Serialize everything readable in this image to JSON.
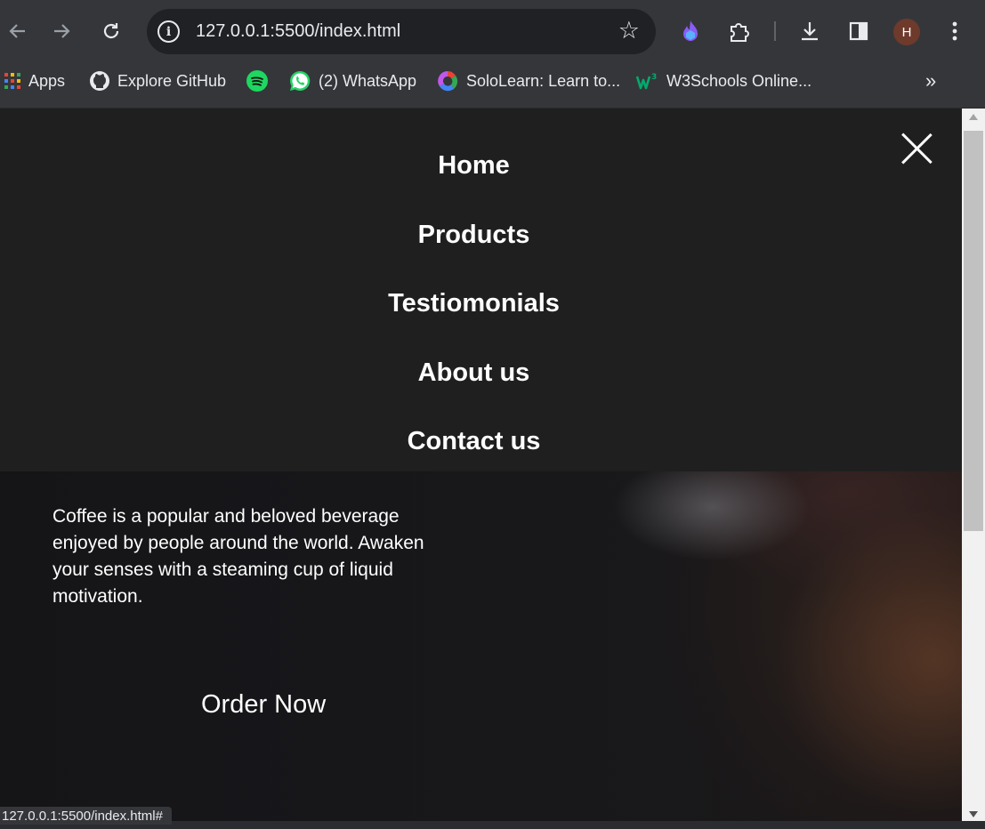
{
  "browser": {
    "url": "127.0.0.1:5500/index.html",
    "avatar_letter": "H",
    "status_url": "127.0.0.1:5500/index.html#",
    "icons": [
      "back-arrow",
      "forward-arrow",
      "reload",
      "site-info",
      "bookmark-star",
      "extension-flame",
      "extensions-puzzle",
      "download",
      "side-panel",
      "more-vert"
    ]
  },
  "bookmarks": {
    "items": [
      {
        "label": "Apps",
        "icon": "apps-grid-icon"
      },
      {
        "label": "Explore GitHub",
        "icon": "github-icon"
      },
      {
        "label": "",
        "icon": "spotify-icon"
      },
      {
        "label": "(2) WhatsApp",
        "icon": "whatsapp-icon"
      },
      {
        "label": "SoloLearn: Learn to...",
        "icon": "sololearn-icon"
      },
      {
        "label": "W3Schools Online...",
        "icon": "w3schools-icon"
      }
    ],
    "overflow": "»"
  },
  "menu": {
    "items": [
      "Home",
      "Products",
      "Testiomonials",
      "About us",
      "Contact us"
    ]
  },
  "hero": {
    "text": "Coffee is a popular and beloved beverage enjoyed by people around the world. Awaken your senses with a steaming cup of liquid motivation.",
    "button_label": "Order Now"
  },
  "colors": {
    "menu_bg": "#1f1f1f",
    "chrome_bg": "#35363a",
    "omnibox_bg": "#202124",
    "avatar_bg": "#6d3a2c",
    "spotify_green": "#1ed760",
    "whatsapp_green": "#25d366"
  }
}
